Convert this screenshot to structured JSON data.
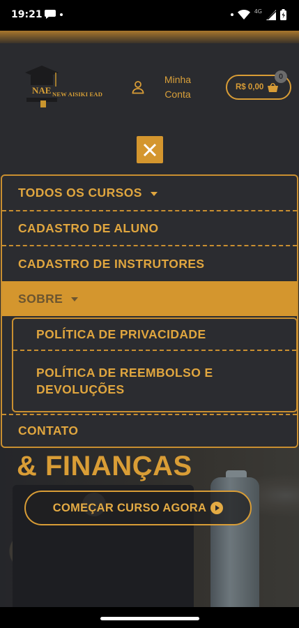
{
  "status_bar": {
    "time": "19:21",
    "network": "4G"
  },
  "header": {
    "logo_brand": "NEW AISIKI EAD",
    "logo_initials": "NAE",
    "account_line1": "Minha",
    "account_line2": "Conta",
    "cart_price": "R$ 0,00",
    "cart_count": "0"
  },
  "menu": {
    "items": [
      {
        "label": "TODOS OS CURSOS",
        "has_dropdown": true
      },
      {
        "label": "CADASTRO DE ALUNO",
        "has_dropdown": false
      },
      {
        "label": "CADASTRO DE INSTRUTORES",
        "has_dropdown": false
      },
      {
        "label": "SOBRE",
        "has_dropdown": true,
        "expanded": true
      },
      {
        "label": "CONTATO",
        "has_dropdown": false
      }
    ],
    "submenu": [
      {
        "label": "POLÍTICA DE PRIVACIDADE"
      },
      {
        "label_line1": "POLÍTICA DE REEMBOLSO E",
        "label_line2": "DEVOLUÇÕES"
      }
    ]
  },
  "hero": {
    "headline": "& FINANÇAS",
    "cta_label": "COMEÇAR CURSO AGORA"
  },
  "colors": {
    "accent": "#d99d36",
    "background": "#2a2b2f",
    "active_item": "#d4962e"
  },
  "icons": [
    "chat-icon",
    "wifi-icon",
    "signal-icon",
    "battery-icon",
    "graduation-cap-icon",
    "user-icon",
    "basket-icon",
    "close-icon",
    "caret-down-icon",
    "play-circle-icon"
  ]
}
